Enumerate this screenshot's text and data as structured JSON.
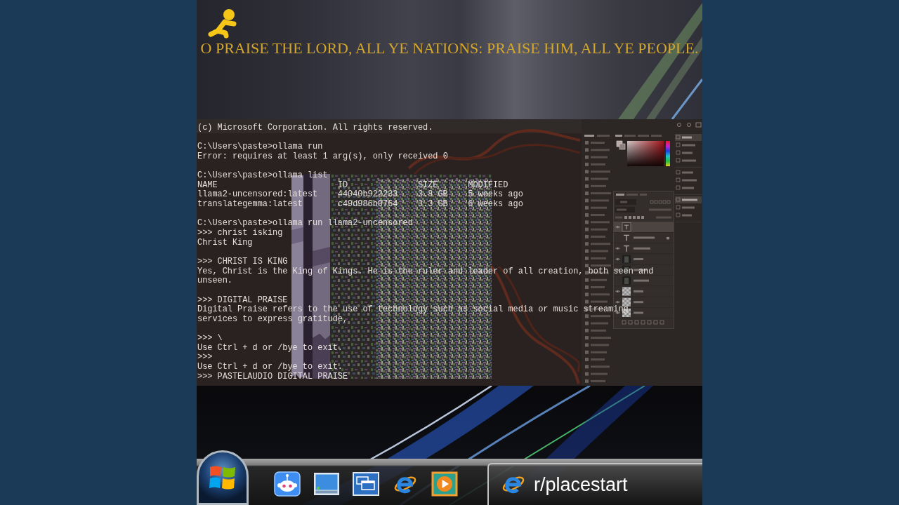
{
  "banner": {
    "text": "O PRAISE THE LORD, ALL YE NATIONS: PRAISE HIM, ALL YE PEOPLE."
  },
  "terminal": {
    "lines": [
      {
        "kind": "output",
        "text": "(c) Microsoft Corporation. All rights reserved."
      },
      {
        "kind": "blank"
      },
      {
        "kind": "command",
        "text": "C:\\Users\\paste>ollama run"
      },
      {
        "kind": "output",
        "text": "Error: requires at least 1 arg(s), only received 0"
      },
      {
        "kind": "blank"
      },
      {
        "kind": "command",
        "text": "C:\\Users\\paste>ollama list"
      },
      {
        "kind": "table",
        "columns": [
          "NAME",
          "ID",
          "SIZE",
          "MODIFIED"
        ],
        "rows": [
          [
            "llama2-uncensored:latest",
            "44040b922233",
            "3.8 GB",
            "5 weeks ago"
          ],
          [
            "translategemma:latest",
            "c49d986b0764",
            "3.3 GB",
            "6 weeks ago"
          ]
        ]
      },
      {
        "kind": "blank"
      },
      {
        "kind": "command",
        "text": "C:\\Users\\paste>ollama run llama2-uncensored"
      },
      {
        "kind": "input",
        "text": ">>> christ isking"
      },
      {
        "kind": "output",
        "text": "Christ King"
      },
      {
        "kind": "blank"
      },
      {
        "kind": "input",
        "text": ">>> CHRIST IS KING"
      },
      {
        "kind": "output",
        "text": "Yes, Christ is the King of Kings. He is the ruler and leader of all creation, both seen and"
      },
      {
        "kind": "output",
        "text": "unseen."
      },
      {
        "kind": "blank"
      },
      {
        "kind": "input",
        "text": ">>> DIGITAL PRAISE"
      },
      {
        "kind": "output",
        "text": "Digital Praise refers to the use of technology such as social media or music streaming"
      },
      {
        "kind": "output",
        "text": "services to express gratitude,"
      },
      {
        "kind": "blank"
      },
      {
        "kind": "input",
        "text": ">>> \\"
      },
      {
        "kind": "output",
        "text": "Use Ctrl + d or /bye to exit."
      },
      {
        "kind": "input",
        "text": ">>>"
      },
      {
        "kind": "output",
        "text": "Use Ctrl + d or /bye to exit."
      },
      {
        "kind": "input",
        "text": ">>> PASTELAUDIO DIGITAL PRAISE"
      }
    ]
  },
  "taskbar": {
    "quick_launch": [
      {
        "kind": "robot"
      },
      {
        "kind": "desktop"
      },
      {
        "kind": "windows"
      },
      {
        "kind": "browser"
      },
      {
        "kind": "media"
      }
    ],
    "task_button": {
      "label": "r/placestart"
    }
  }
}
